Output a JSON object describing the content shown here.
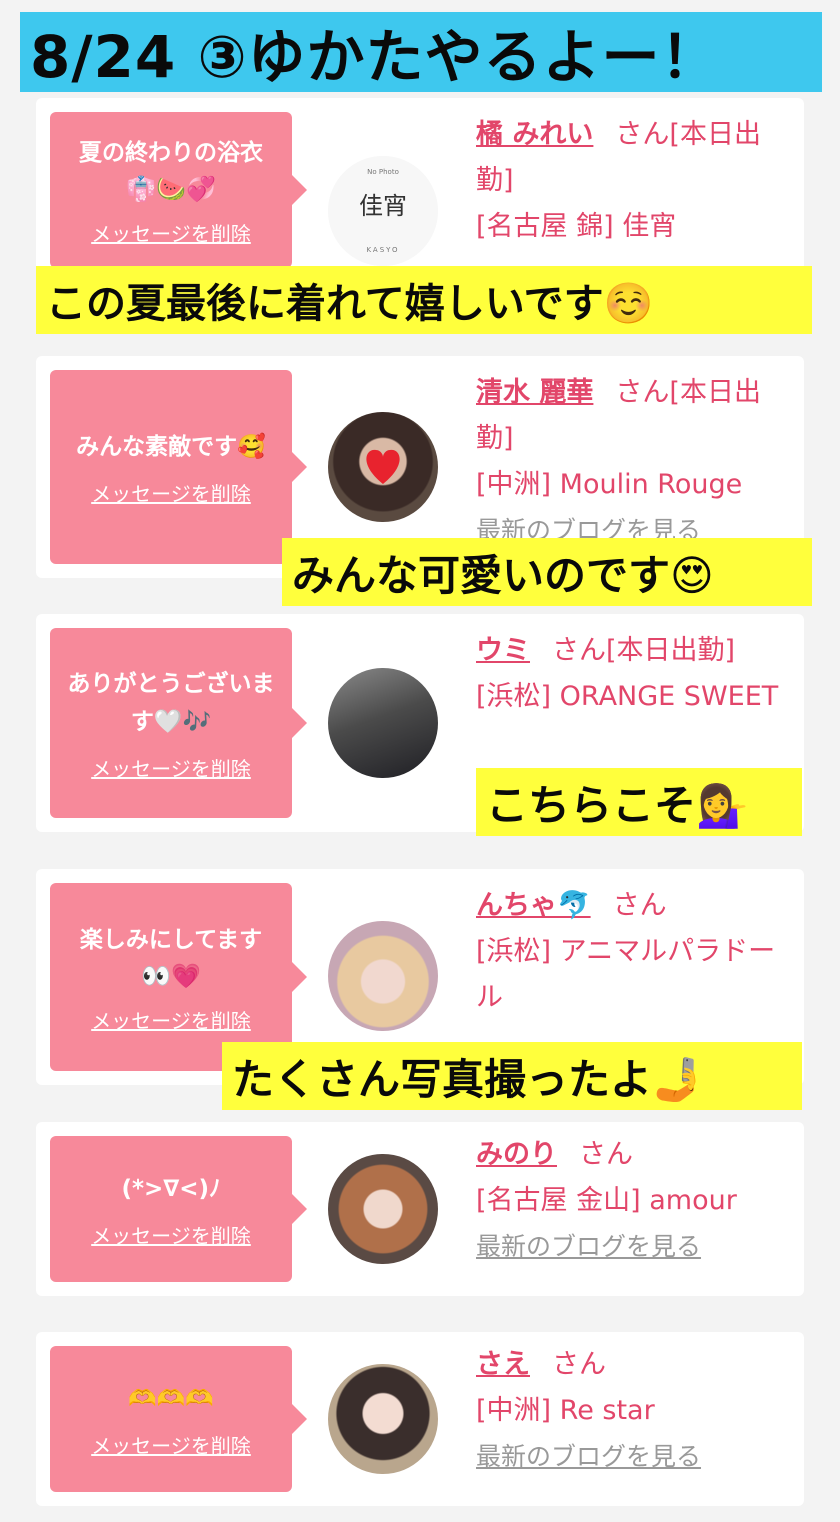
{
  "header": {
    "title": "8/24 ③ゆかたやるよー！"
  },
  "delete_label": "メッセージを削除",
  "blog_label": "最新のブログを見る",
  "cards": [
    {
      "message": "夏の終わりの浴衣",
      "emoji": "👘🍉💞",
      "name": "橘 みれい",
      "suffix": "さん[本日出勤]",
      "shop": "[名古屋 錦] 佳宵",
      "avatar_text": "佳宵",
      "avatar_top": "No Photo",
      "avatar_bottom": "KASYO"
    },
    {
      "message": "みんな素敵です🥰",
      "name": "清水 麗華",
      "suffix": "さん[本日出勤]",
      "shop": "[中洲] Moulin Rouge",
      "blog": "最新のブログを見る"
    },
    {
      "message": "ありがとうございます🤍🎶",
      "name": "ウミ",
      "suffix": "さん[本日出勤]",
      "shop": "[浜松] ORANGE SWEET"
    },
    {
      "message": "楽しみにしてます",
      "emoji": "👀💗",
      "name": "んちゃ🐬",
      "suffix": "さん",
      "shop": "[浜松] アニマルパラドール"
    },
    {
      "message": "(*>∇<)ﾉ",
      "name": "みのり",
      "suffix": "さん",
      "shop": "[名古屋 金山] amour",
      "blog": "最新のブログを見る"
    },
    {
      "message": "🫶🫶🫶",
      "name": "さえ",
      "suffix": "さん",
      "shop": "[中洲] Re star",
      "blog": "最新のブログを見る"
    }
  ],
  "captions": [
    "この夏最後に着れて嬉しいです☺️",
    "みんな可愛いのです😍",
    "こちらこそ💁‍♀️",
    "たくさん写真撮ったよ🤳"
  ],
  "colors": {
    "header_bg": "#3ec8ee",
    "bubble": "#f7899a",
    "accent": "#e2466a",
    "caption_bg": "#ffff3c"
  }
}
